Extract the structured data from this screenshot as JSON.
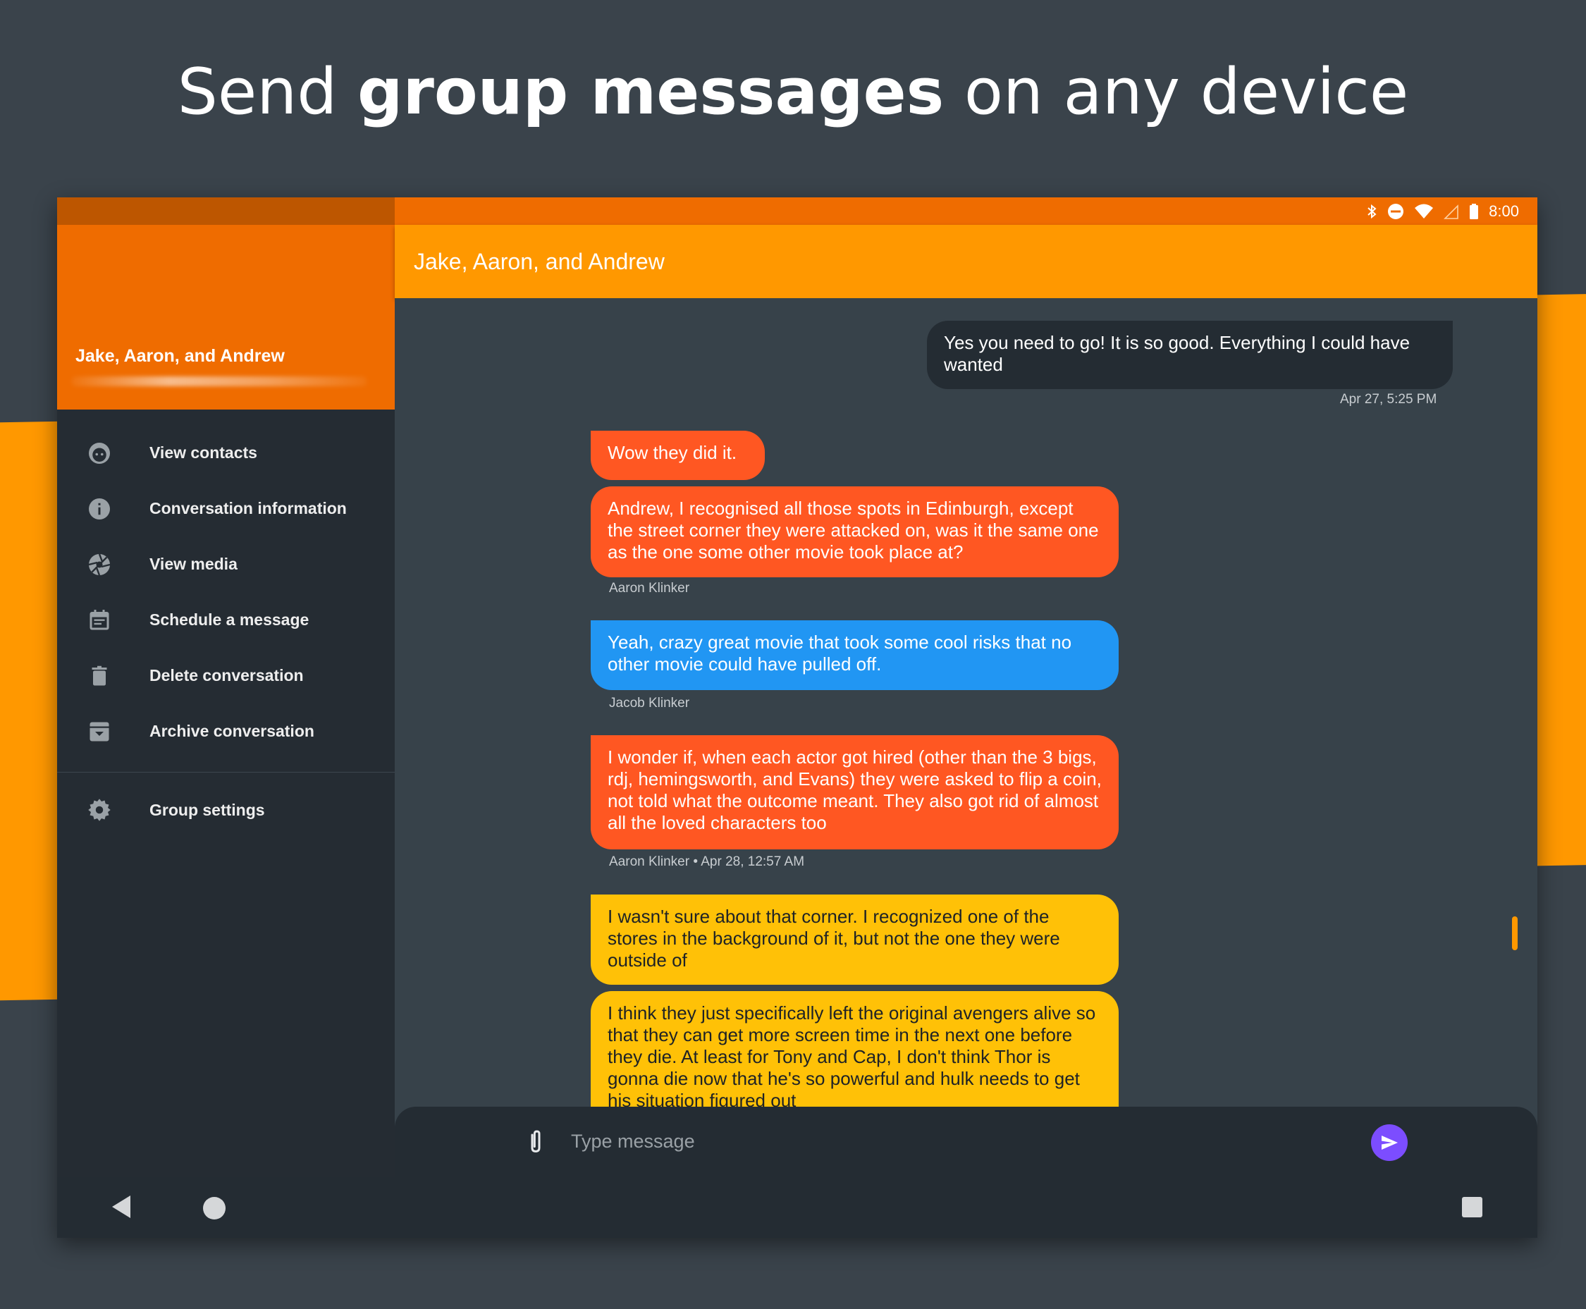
{
  "headline": {
    "pre": "Send ",
    "bold": "group messages",
    "post": " on any device"
  },
  "status_bar": {
    "time": "8:00"
  },
  "drawer": {
    "title": "Jake, Aaron, and Andrew",
    "items": [
      {
        "label": "View contacts",
        "icon": "face-icon"
      },
      {
        "label": "Conversation information",
        "icon": "info-icon"
      },
      {
        "label": "View media",
        "icon": "camera-shutter-icon"
      },
      {
        "label": "Schedule a message",
        "icon": "calendar-icon"
      },
      {
        "label": "Delete conversation",
        "icon": "trash-icon"
      },
      {
        "label": "Archive conversation",
        "icon": "archive-icon"
      }
    ],
    "settings": {
      "label": "Group settings",
      "icon": "gear-icon"
    }
  },
  "toolbar": {
    "title": "Jake, Aaron, and Andrew"
  },
  "messages": [
    {
      "text": "Yes you need to go! It is so good. Everything I could have wanted",
      "meta": "Apr 27, 5:25 PM",
      "color": "#242c33",
      "outgoing": true
    },
    {
      "text": "Wow they did it.",
      "meta": "",
      "color": "#ff5722"
    },
    {
      "text": "Andrew, I recognised all those spots in Edinburgh, except the street corner they were attacked on, was it the same one as the one some other movie took place at?",
      "meta": "Aaron Klinker",
      "color": "#ff5722"
    },
    {
      "text": "Yeah, crazy great movie that took some cool risks that no other movie could have pulled off.",
      "meta": "Jacob Klinker",
      "color": "#2196f3"
    },
    {
      "text": "I wonder if, when each actor got hired (other than the 3 bigs, rdj, hemingsworth, and Evans) they were asked to flip a coin, not told what the outcome meant. They also got rid of almost all the loved characters too",
      "meta": "Aaron Klinker • Apr 28, 12:57 AM",
      "color": "#ff5722"
    },
    {
      "text": "I wasn't sure about that corner. I recognized one of the stores in the background of it, but not the one they were outside of",
      "meta": "",
      "color": "#ffc107"
    },
    {
      "text": "I think they just specifically left the original avengers alive so that they can get more screen time in the next one before they die. At least for Tony and Cap, I don't think Thor is gonna die now that he's so powerful and hulk needs to get his situation figured out",
      "meta": "",
      "color": "#ffc107"
    }
  ],
  "composer": {
    "placeholder": "Type message"
  },
  "colors": {
    "accent": "#ff9800",
    "primary_dark": "#ef6c00",
    "send": "#7c4dff"
  }
}
